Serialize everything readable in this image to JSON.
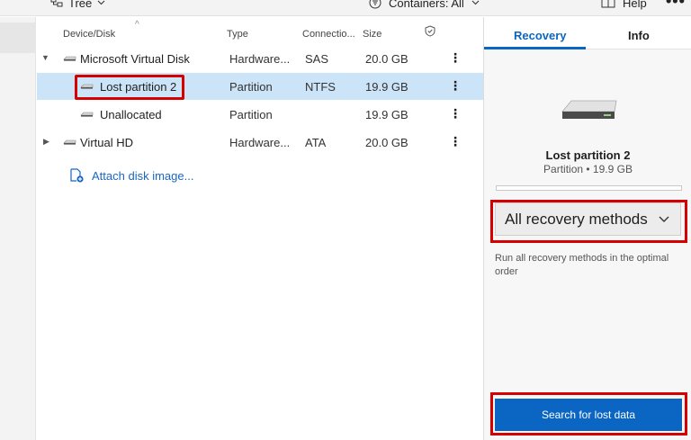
{
  "toolbar": {
    "view_label": "Tree",
    "containers_label": "Containers: All",
    "help_label": "Help",
    "more_label": "•••"
  },
  "table": {
    "columns": [
      "Device/Disk",
      "Type",
      "Connectio...",
      "Size"
    ],
    "rows": [
      {
        "name": "Microsoft Virtual Disk",
        "type": "Hardware...",
        "connection": "SAS",
        "size": "20.0 GB",
        "expanded": true
      },
      {
        "name": "Lost partition 2",
        "type": "Partition",
        "connection": "NTFS",
        "size": "19.9 GB",
        "selected": true
      },
      {
        "name": "Unallocated",
        "type": "Partition",
        "connection": "",
        "size": "19.9 GB"
      },
      {
        "name": "Virtual HD",
        "type": "Hardware...",
        "connection": "ATA",
        "size": "20.0 GB",
        "expanded": false
      }
    ],
    "attach_label": "Attach disk image...",
    "row_menu": "⋮"
  },
  "right_pane": {
    "tabs": [
      "Recovery",
      "Info"
    ],
    "selected_name": "Lost partition 2",
    "selected_info": "Partition • 19.9 GB",
    "method_selected": "All recovery methods",
    "method_description": "Run all recovery methods in the optimal order",
    "search_button": "Search for lost data"
  },
  "colors": {
    "accent": "#0a66c2",
    "selection": "#cce4f7",
    "highlight": "#d50000"
  }
}
